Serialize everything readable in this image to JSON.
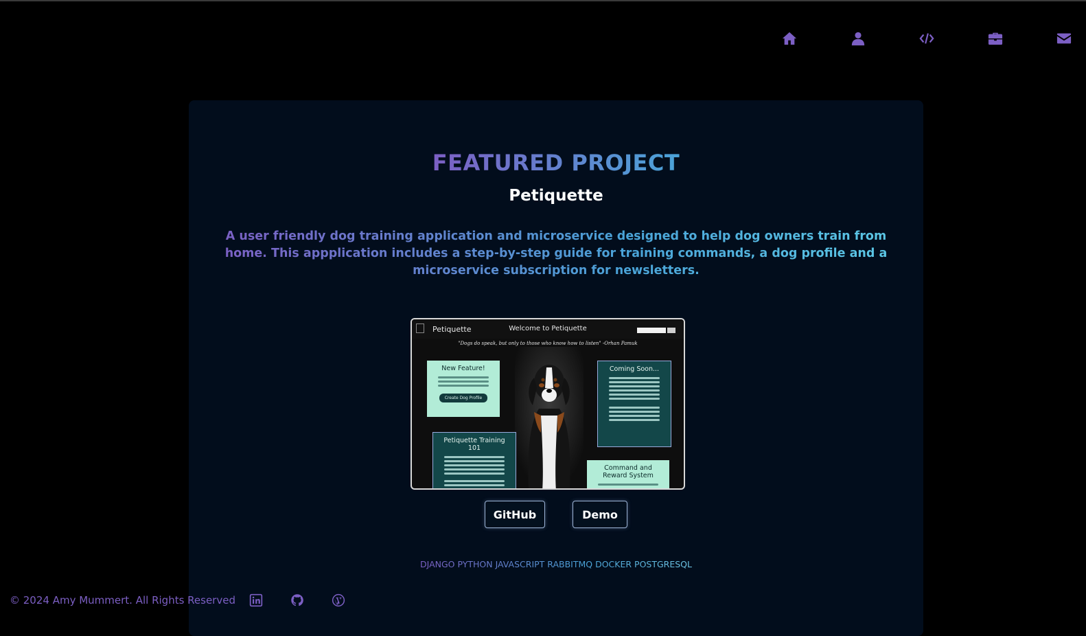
{
  "nav": {
    "items": [
      {
        "icon": "home-icon"
      },
      {
        "icon": "user-icon"
      },
      {
        "icon": "code-icon"
      },
      {
        "icon": "briefcase-icon"
      },
      {
        "icon": "envelope-icon"
      }
    ],
    "icon_color": "#7c5fc4"
  },
  "featured": {
    "heading": "FEATURED PROJECT",
    "project_name": "Petiquette",
    "description": "A user friendly dog training application and microservice designed to help dog owners train from home. This appplication includes a step-by-step guide for training commands, a dog profile and a microservice subscription for newsletters.",
    "screenshot": {
      "brand": "Petiquette",
      "welcome": "Welcome to Petiquette",
      "quote": "\"Dogs do speak, but only to those who know how to listen\" -Orhan Pamuk",
      "panels": {
        "new_feature": {
          "title": "New Feature!",
          "button": "Create Dog Profile"
        },
        "coming_soon": {
          "title": "Coming Soon..."
        },
        "training": {
          "title": "Petiquette Training 101"
        },
        "command": {
          "title": "Command and Reward System"
        }
      }
    },
    "buttons": {
      "github": "GitHub",
      "demo": "Demo"
    },
    "tech_stack": "DJANGO PYTHON JAVASCRIPT RABBITMQ DOCKER POSTGRESQL"
  },
  "footer": {
    "copyright": "© 2024 Amy Mummert. All Rights Reserved",
    "social": [
      {
        "icon": "linkedin-icon"
      },
      {
        "icon": "github-icon"
      },
      {
        "icon": "wordpress-icon"
      }
    ]
  },
  "colors": {
    "accent_purple": "#7c5fc4",
    "accent_blue": "#4aa3d8",
    "card_bg": "#020d1c",
    "page_bg": "#000000"
  }
}
